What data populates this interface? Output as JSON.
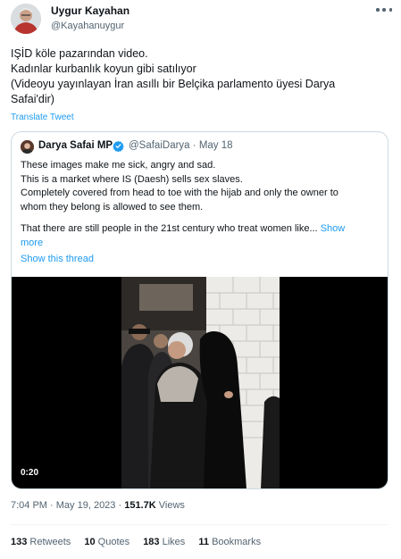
{
  "author": {
    "name": "Uygur Kayahan",
    "handle": "@Kayahanuygur"
  },
  "tweet": {
    "lines": [
      "IŞİD köle pazarından video.",
      "Kadınlar kurbanlık koyun gibi satılıyor",
      "(Videoyu yayınlayan İran asıllı bir Belçika parlamento üyesi Darya",
      "Safai'dir)"
    ],
    "translate_label": "Translate Tweet"
  },
  "quote": {
    "name": "Darya Safai MP",
    "handle": "@SafaiDarya",
    "separator": "·",
    "date": "May 18",
    "lines": [
      "These images make me sick, angry and sad.",
      "This is a market where IS (Daesh) sells sex slaves.",
      "Completely covered from head to toe with the hijab and only the owner to",
      "whom they belong is allowed to see them."
    ],
    "line_last_a": "That there are still people in the 21st century who treat women like...",
    "show_more_a": "Show",
    "show_more_b": "more",
    "show_thread": "Show this thread",
    "video_time": "0:20"
  },
  "meta": {
    "time": "7:04 PM",
    "separator": "·",
    "date": "May 19, 2023",
    "views_count": "151.7K",
    "views_label": "Views"
  },
  "stats": {
    "retweets_count": "133",
    "retweets_label": "Retweets",
    "quotes_count": "10",
    "quotes_label": "Quotes",
    "likes_count": "183",
    "likes_label": "Likes",
    "bookmarks_count": "11",
    "bookmarks_label": "Bookmarks"
  },
  "colors": {
    "link": "#1d9bf0",
    "secondary_text": "#536471",
    "border": "#cfd9de"
  },
  "icons": {
    "more": "more-icon",
    "verified": "verified-badge-icon"
  }
}
